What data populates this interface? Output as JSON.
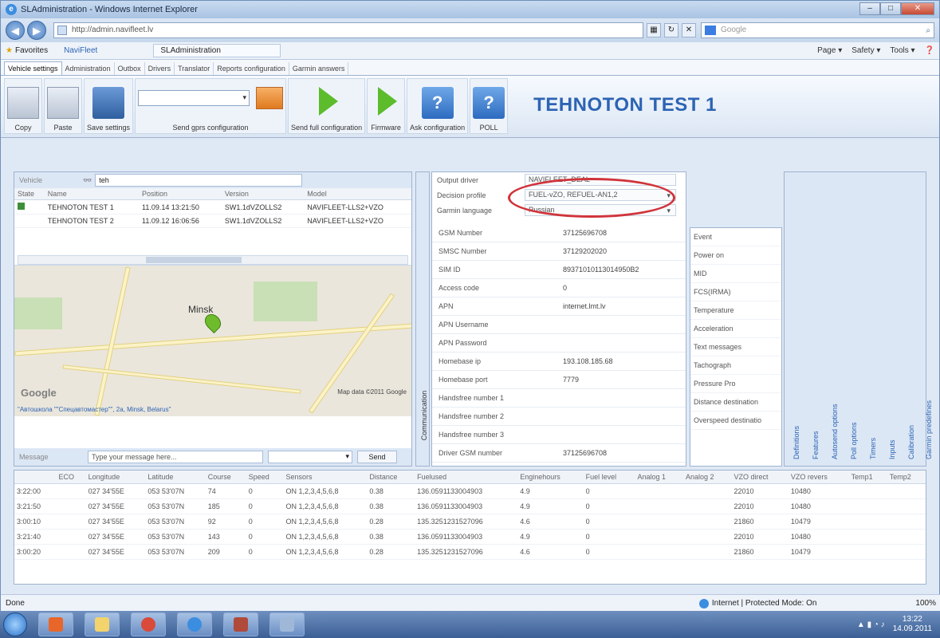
{
  "browser": {
    "title": "SLAdministration - Windows Internet Explorer",
    "url": "http://admin.navifleet.lv",
    "search_placeholder": "Google",
    "favorites_label": "Favorites",
    "fav_item": "NaviFleet",
    "tab_label": "SLAdministration",
    "menu": [
      "Page ▾",
      "Safety ▾",
      "Tools ▾"
    ],
    "status_done": "Done",
    "zone_text": "Internet | Protected Mode: On",
    "zoom": "100%"
  },
  "app_tabs": [
    "Vehicle settings",
    "Administration",
    "Outbox",
    "Drivers",
    "Translator",
    "Reports configuration",
    "Garmin answers"
  ],
  "toolbar": {
    "copy": "Copy",
    "paste": "Paste",
    "save": "Save settings",
    "send_gprs": "Send gprs configuration",
    "send_full": "Send full configuration",
    "firmware": "Firmware",
    "ask": "Ask configuration",
    "poll": "POLL"
  },
  "vehicle_title": "TEHNOTON TEST 1",
  "vehicles": {
    "filter_label": "Vehicle",
    "filter_value": "teh",
    "headers": [
      "State",
      "Name",
      "Position",
      "Version",
      "Model"
    ],
    "rows": [
      {
        "name": "TEHNOTON TEST 1",
        "position": "11.09.14 13:21:50",
        "version": "SW1.1dVZOLLS2",
        "model": "NAVIFLEET-LLS2+VZO"
      },
      {
        "name": "TEHNOTON TEST 2",
        "position": "11.09.12 16:06:56",
        "version": "SW1.1dVZOLLS2",
        "model": "NAVIFLEET-LLS2+VZO"
      }
    ]
  },
  "map": {
    "city": "Minsk",
    "credit": "Map data ©2011 Google",
    "logo": "Google",
    "address": "\"Автошкола \"\"Спецавтомастер\"\", 2a, Minsk, Belarus\""
  },
  "message": {
    "label": "Message",
    "placeholder": "Type your message here...",
    "send": "Send"
  },
  "comm_tab": "Communication",
  "settings": {
    "top": [
      {
        "k": "Output driver",
        "v": "NAVIFLEET_DEAL"
      },
      {
        "k": "Decision profile",
        "v": "FUEL-vZO, REFUEL-AN1,2"
      },
      {
        "k": "Garmin language",
        "v": "Russian"
      }
    ],
    "rows": [
      {
        "k": "GSM Number",
        "v": "37125696708"
      },
      {
        "k": "SMSC Number",
        "v": "37129202020"
      },
      {
        "k": "SIM ID",
        "v": "89371010113014950B2"
      },
      {
        "k": "Access code",
        "v": "0"
      },
      {
        "k": "APN",
        "v": "internet.lmt.lv"
      },
      {
        "k": "APN Username",
        "v": ""
      },
      {
        "k": "APN Password",
        "v": ""
      },
      {
        "k": "Homebase ip",
        "v": "193.108.185.68"
      },
      {
        "k": "Homebase port",
        "v": "7779"
      },
      {
        "k": "Handsfree number 1",
        "v": ""
      },
      {
        "k": "Handsfree number 2",
        "v": ""
      },
      {
        "k": "Handsfree number 3",
        "v": ""
      },
      {
        "k": "Driver GSM number",
        "v": "37125696708"
      }
    ]
  },
  "events": [
    "Event",
    "Power on",
    "MID",
    "FCS(IRMA)",
    "Temperature",
    "Acceleration",
    "Text messages",
    "Tachograph",
    "Pressure Pro",
    "Distance destination",
    "Overspeed destinatio"
  ],
  "vtabs": [
    "Definitions",
    "Features",
    "Autosend options",
    "Poll options",
    "Timers",
    "Inputs",
    "Calibration",
    "Garmin predefines"
  ],
  "grid": {
    "headers": [
      "",
      "ECO",
      "Longitude",
      "Latitude",
      "Course",
      "Speed",
      "Sensors",
      "Distance",
      "Fuelused",
      "Enginehours",
      "Fuel level",
      "Analog 1",
      "Analog 2",
      "VZO direct",
      "VZO revers",
      "Temp1",
      "Temp2"
    ],
    "rows": [
      [
        "3:22:00",
        "",
        "027 34'55E",
        "053 53'07N",
        "74",
        "0",
        "ON 1,2,3,4,5,6,8",
        "0.38",
        "136.0591133004903",
        "4.9",
        "0",
        "",
        "",
        "22010",
        "10480",
        "",
        ""
      ],
      [
        "3:21:50",
        "",
        "027 34'55E",
        "053 53'07N",
        "185",
        "0",
        "ON 1,2,3,4,5,6,8",
        "0.38",
        "136.0591133004903",
        "4.9",
        "0",
        "",
        "",
        "22010",
        "10480",
        "",
        ""
      ],
      [
        "3:00:10",
        "",
        "027 34'55E",
        "053 53'07N",
        "92",
        "0",
        "ON 1,2,3,4,5,6,8",
        "0.28",
        "135.3251231527096",
        "4.6",
        "0",
        "",
        "",
        "21860",
        "10479",
        "",
        ""
      ],
      [
        "3:21:40",
        "",
        "027 34'55E",
        "053 53'07N",
        "143",
        "0",
        "ON 1,2,3,4,5,6,8",
        "0.38",
        "136.0591133004903",
        "4.9",
        "0",
        "",
        "",
        "22010",
        "10480",
        "",
        ""
      ],
      [
        "3:00:20",
        "",
        "027 34'55E",
        "053 53'07N",
        "209",
        "0",
        "ON 1,2,3,4,5,6,8",
        "0.28",
        "135.3251231527096",
        "4.6",
        "0",
        "",
        "",
        "21860",
        "10479",
        "",
        ""
      ]
    ]
  },
  "clock": {
    "time": "13:22",
    "date": "14.09.2011"
  }
}
